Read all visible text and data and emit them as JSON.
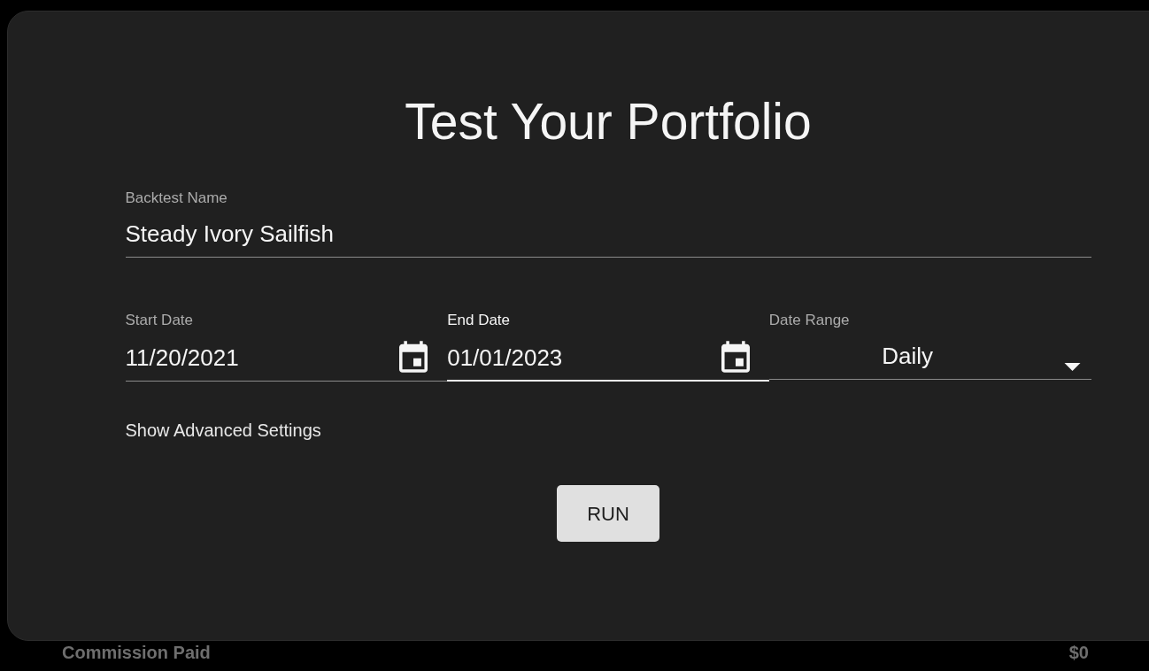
{
  "dialog": {
    "title": "Test Your Portfolio",
    "name_field": {
      "kind": "text",
      "label": "Backtest Name",
      "value": "Steady Ivory Sailfish",
      "focused": false
    },
    "date_fields": [
      {
        "kind": "date",
        "label": "Start Date",
        "value": "11/20/2021",
        "focused": false
      },
      {
        "kind": "date",
        "label": "End Date",
        "value": "01/01/2023",
        "focused": true
      },
      {
        "kind": "select",
        "label": "Date Range",
        "value": "Daily",
        "focused": false
      }
    ],
    "advanced_toggle": "Show Advanced Settings",
    "run_button": "RUN"
  },
  "summary_row": {
    "label": "Commission Paid",
    "value": "$0"
  }
}
